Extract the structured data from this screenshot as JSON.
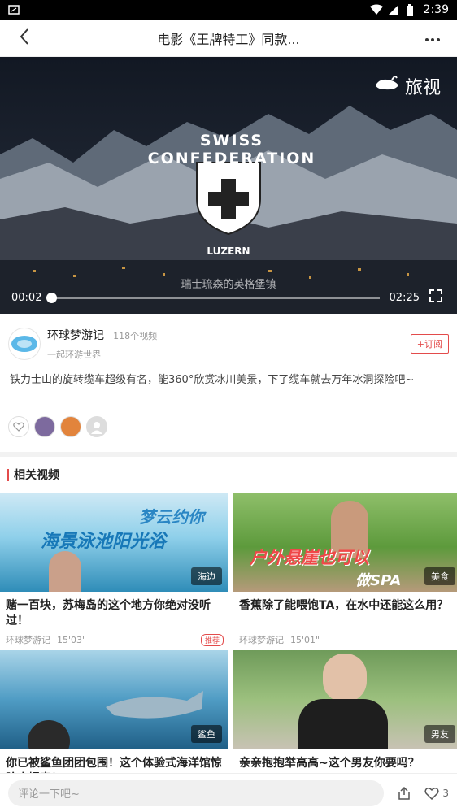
{
  "status_bar": {
    "time": "2:39"
  },
  "header": {
    "title": "电影《王牌特工》同款..."
  },
  "video": {
    "brand": "旅视",
    "emblem_text": "SWISS CONFEDERATION",
    "emblem_sub": "LUZERN",
    "caption": "瑞士琉森的英格堡镇",
    "current_time": "00:02",
    "total_time": "02:25",
    "progress": 0.0
  },
  "channel": {
    "name": "环球梦游记",
    "video_count": "118个视频",
    "subtitle": "一起环游世界",
    "subscribe_label": "+订阅"
  },
  "description": "铁力士山的旋转缆车超级有名，能360°欣赏冰川美景，下了缆车就去万年冰洞探险吧~",
  "related": {
    "title": "相关视频",
    "items": [
      {
        "title": "赌一百块，苏梅岛的这个地方你绝对没听过！",
        "author": "环球梦游记",
        "duration": "15'03\"",
        "tag": "海边",
        "badge": "推荐",
        "overlay_text": "海景泳池阳光浴",
        "overlay_text2": "梦云约你"
      },
      {
        "title": "香蕉除了能喂饱TA，在水中还能这么用？",
        "author": "环球梦游记",
        "duration": "15'01\"",
        "tag": "美食",
        "badge": "",
        "overlay_text": "户外悬崖也可以",
        "overlay_text2": "做SPA"
      },
      {
        "title": "你已被鲨鱼团团包围！这个体验式海洋馆惊险度爆表！",
        "author": "",
        "duration": "",
        "tag": "鲨鱼",
        "badge": ""
      },
      {
        "title": "亲亲抱抱举高高~这个男友你要吗？",
        "author": "",
        "duration": "",
        "tag": "男友",
        "badge": ""
      }
    ]
  },
  "bottom_bar": {
    "comment_placeholder": "评论一下吧~",
    "like_count": "3"
  }
}
